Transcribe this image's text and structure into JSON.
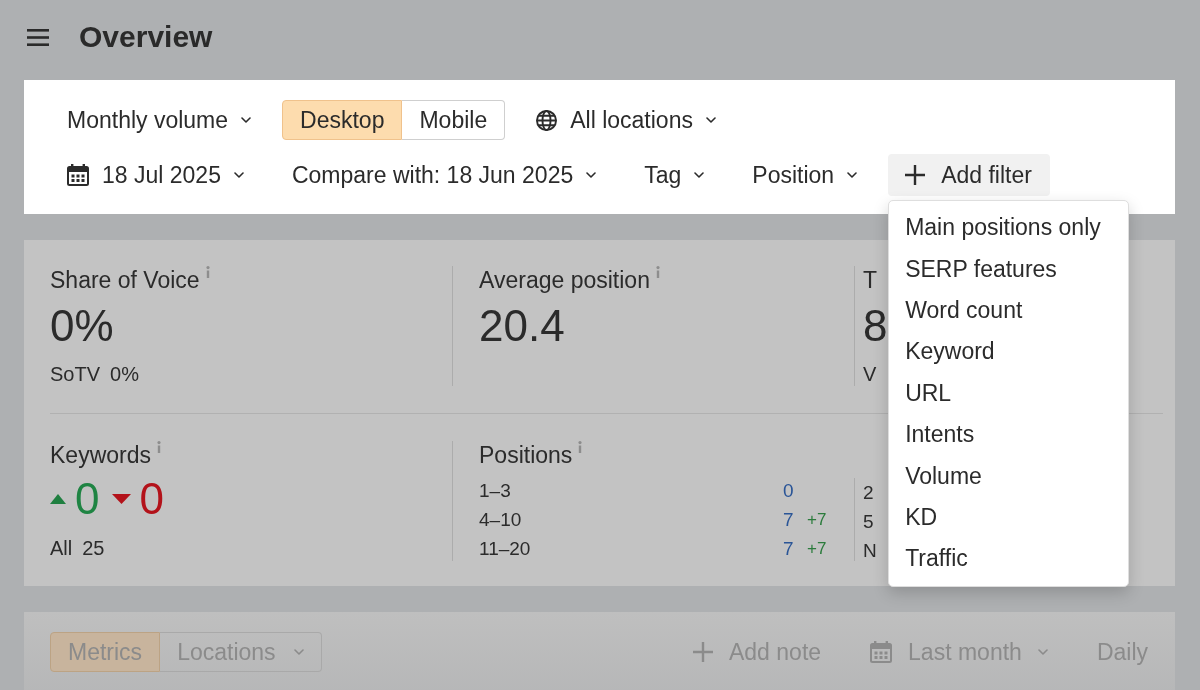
{
  "header": {
    "title": "Overview"
  },
  "filters": {
    "rows": [
      [
        {
          "kind": "dropdown",
          "label": "Monthly volume"
        },
        {
          "kind": "segmented",
          "options": [
            {
              "label": "Desktop",
              "selected": true
            },
            {
              "label": "Mobile",
              "selected": false
            }
          ]
        },
        {
          "kind": "location",
          "label": "All locations"
        }
      ],
      [
        {
          "kind": "date",
          "label": "18 Jul 2025"
        },
        {
          "kind": "dropdown",
          "label": "Compare with: 18 Jun 2025"
        },
        {
          "kind": "dropdown",
          "label": "Tag"
        },
        {
          "kind": "dropdown",
          "label": "Position"
        },
        {
          "kind": "add",
          "label": "Add filter",
          "menu": [
            "Main positions only",
            "SERP features",
            "Word count",
            "Keyword",
            "URL",
            "Intents",
            "Volume",
            "KD",
            "Traffic"
          ]
        }
      ]
    ]
  },
  "metrics": {
    "top": [
      {
        "title": "Share of Voice",
        "info": true,
        "value": "0%",
        "sub_label": "SoTV",
        "sub_value": "0%"
      },
      {
        "title": "Average position",
        "info": true,
        "value": "20.4"
      },
      {
        "title": "T",
        "info": false,
        "value": "8",
        "sub_label": "V"
      }
    ],
    "bottom": [
      {
        "kind": "trend",
        "title": "Keywords",
        "info": true,
        "up": "0",
        "down": "0",
        "sub_label": "All",
        "sub_value": "25"
      },
      {
        "kind": "positions",
        "title": "Positions",
        "info": true,
        "rows": [
          {
            "range": "1–3",
            "value": "0"
          },
          {
            "range": "4–10",
            "value": "7",
            "change": "+7"
          },
          {
            "range": "11–20",
            "value": "7",
            "change": "+7"
          }
        ]
      },
      {
        "kind": "positions",
        "rows": [
          {
            "range": "2"
          },
          {
            "range": "5"
          },
          {
            "range": "N"
          }
        ]
      }
    ]
  },
  "chart_toolbar": {
    "tabs": [
      {
        "kind": "tab",
        "label": "Metrics",
        "selected": true
      },
      {
        "kind": "dropdown",
        "label": "Locations",
        "selected": false
      }
    ],
    "actions": [
      {
        "kind": "add",
        "label": "Add note"
      },
      {
        "kind": "date",
        "label": "Last month"
      },
      {
        "kind": "text",
        "label": "Daily"
      }
    ]
  }
}
